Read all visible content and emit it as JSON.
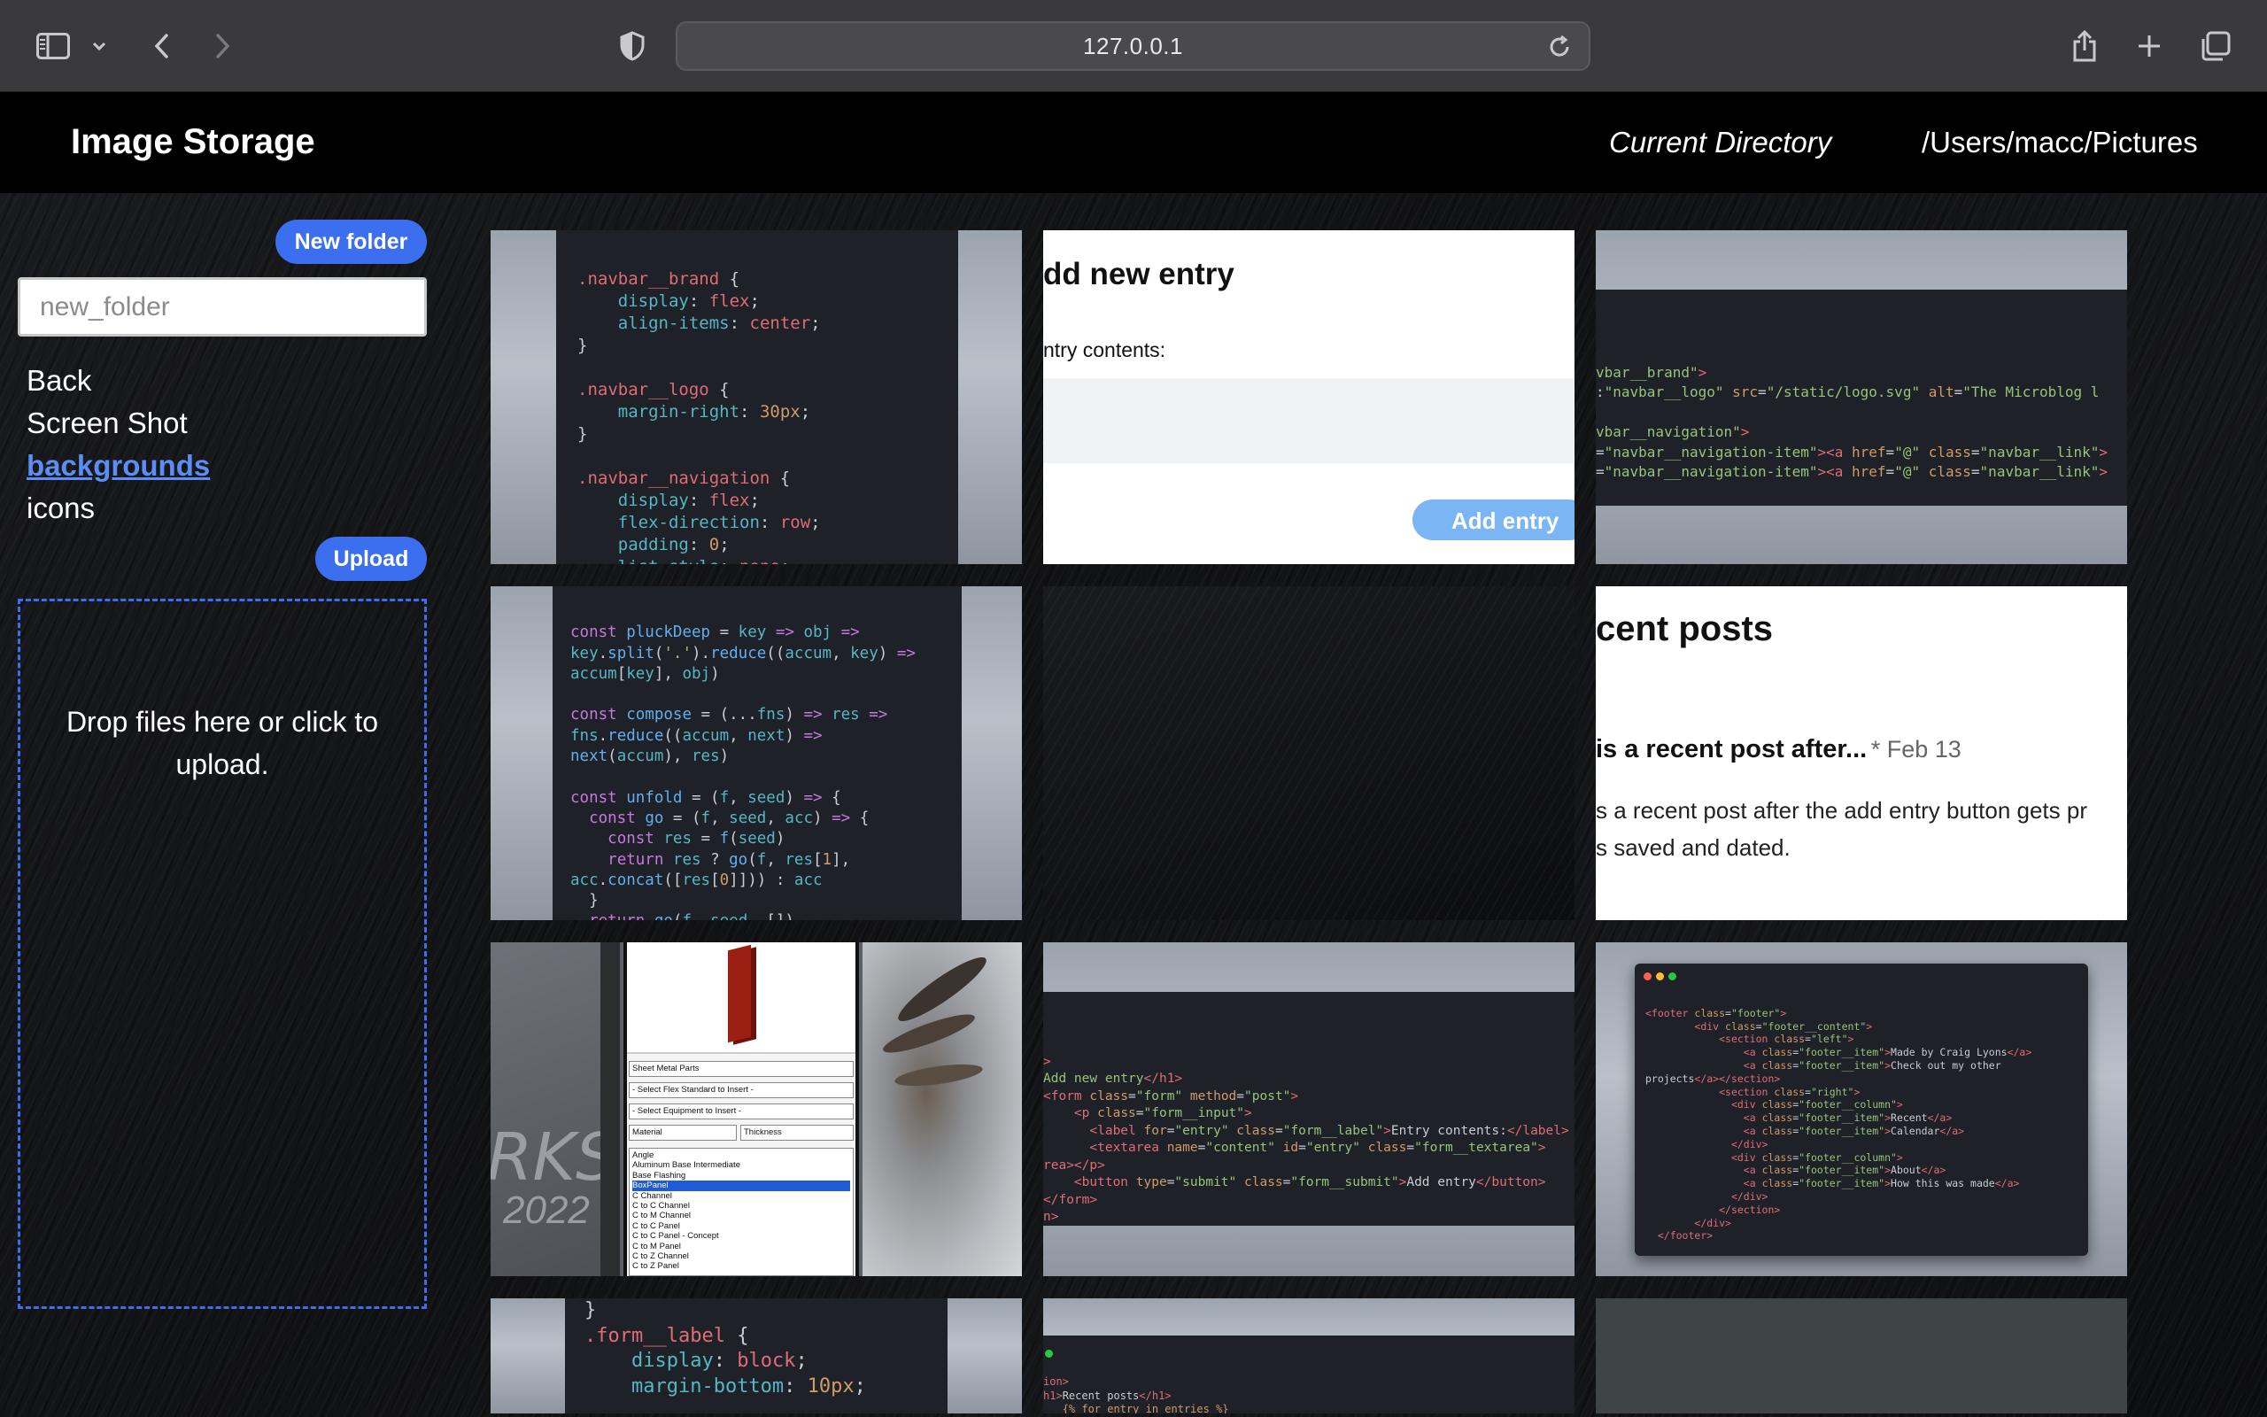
{
  "browser": {
    "url": "127.0.0.1"
  },
  "header": {
    "brand": "Image Storage",
    "current_directory_label": "Current Directory",
    "current_directory_path": "/Users/macc/Pictures"
  },
  "sidebar": {
    "new_folder_button": "New folder",
    "folder_input_placeholder": "new_folder",
    "folders": [
      {
        "label": "Back",
        "active": false
      },
      {
        "label": "Screen Shot",
        "active": false
      },
      {
        "label": "backgrounds",
        "active": true
      },
      {
        "label": "icons",
        "active": false
      }
    ],
    "upload_button": "Upload",
    "dropzone_text": "Drop files here or click to upload."
  },
  "thumbnails": {
    "t2": {
      "heading": "dd new entry",
      "label": "ntry contents:",
      "button": "Add entry"
    },
    "t6": {
      "heading": "cent posts",
      "post_title": "is a recent post after...",
      "post_date": "* Feb 13",
      "post_body_1": "s a recent post after the add entry button gets pr",
      "post_body_2": "s saved and dated."
    },
    "t7": {
      "watermark_1": "RKS",
      "watermark_2": "2022",
      "select_1": "Sheet Metal Parts",
      "select_2": "- Select Flex Standard to Insert -",
      "select_3": "- Select Equipment to Insert -",
      "select_4": "Material",
      "select_5": "Thickness",
      "list_items": [
        "Angle",
        "Aluminum Base Intermediate",
        "Base Flashing",
        "BoxPanel",
        "C Channel",
        "C to C Channel",
        "C to M Channel",
        "C to C Panel",
        "C to C Panel - Concept",
        "C to M Panel",
        "C to Z Channel",
        "C to Z Panel"
      ]
    }
  },
  "colors": {
    "accent": "#3b6ff0",
    "active_link": "#5b8ef5",
    "topbar": "#000000",
    "chrome": "#3a3a3c"
  }
}
